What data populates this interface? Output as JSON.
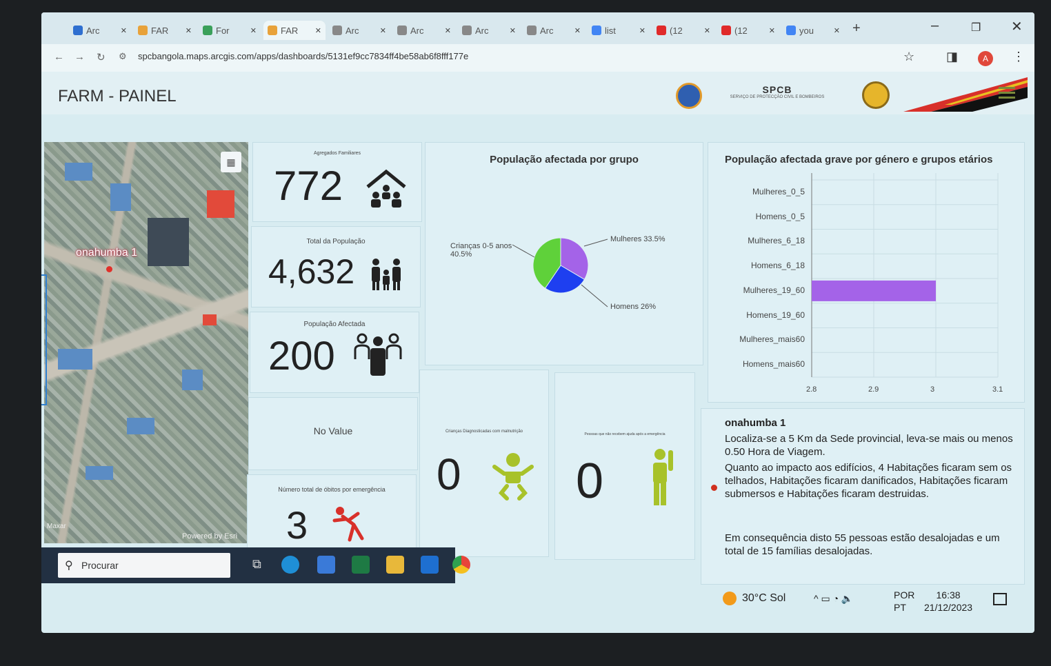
{
  "browser": {
    "tabs": [
      {
        "label": "Arc",
        "color": "#2f6fd0"
      },
      {
        "label": "FAR",
        "color": "#e8a23a"
      },
      {
        "label": "For",
        "color": "#3aa05a"
      },
      {
        "label": "FAR",
        "color": "#e8a23a",
        "active": true
      },
      {
        "label": "Arc",
        "color": "#888888"
      },
      {
        "label": "Arc",
        "color": "#888888"
      },
      {
        "label": "Arc",
        "color": "#888888"
      },
      {
        "label": "Arc",
        "color": "#888888"
      },
      {
        "label": "list",
        "color": "#4285f4"
      },
      {
        "label": "(12",
        "color": "#e02a2a"
      },
      {
        "label": "(12",
        "color": "#e02a2a"
      },
      {
        "label": "you",
        "color": "#4285f4"
      }
    ],
    "url": "spcbangola.maps.arcgis.com/apps/dashboards/5131ef9cc7834ff4be58ab6f8fff177e",
    "avatar": "A"
  },
  "dashboard": {
    "title": "FARM - PAINEL",
    "logo_text": "SPCB",
    "logo_subtext": "SERVIÇO DE PROTECÇÃO CIVIL E BOMBEIROS"
  },
  "map": {
    "label": "onahumba 1",
    "attribution": "Powered by Esri",
    "provider": "Maxar"
  },
  "kpis": {
    "agregados": {
      "caption": "Agregados Familiares",
      "value": "772"
    },
    "populacao": {
      "caption": "Total da População",
      "value": "4,632"
    },
    "afectada": {
      "caption": "População Afectada",
      "value": "200"
    },
    "novalue": {
      "caption": "No Value"
    },
    "obitos": {
      "caption": "Número total de óbitos por emergência",
      "value": "3"
    },
    "criancas": {
      "caption": "Crianças Diagnosticadas com malnutrição",
      "value": "0"
    },
    "pessoas": {
      "caption": "Pessoas que não recebem ajuda após a emergência",
      "value": "0"
    }
  },
  "pie": {
    "title": "População afectada por grupo",
    "chart_data": {
      "type": "pie",
      "slices": [
        {
          "label": "Mulheres",
          "value": 33.5,
          "color": "#a463e8"
        },
        {
          "label": "Homens",
          "value": 26,
          "color": "#1e3ff0"
        },
        {
          "label": "Crianças 0-5 anos",
          "value": 40.5,
          "color": "#5fd13a"
        }
      ]
    },
    "labels": {
      "criancas_1": "Crianças 0-5 anos",
      "criancas_2": "40.5%",
      "mulheres": "Mulheres 33.5%",
      "homens": "Homens 26%"
    }
  },
  "bar": {
    "title": "População afectada grave por género e grupos etários",
    "chart_data": {
      "type": "bar",
      "orientation": "horizontal",
      "categories": [
        "Mulheres_0_5",
        "Homens_0_5",
        "Mulheres_6_18",
        "Homens_6_18",
        "Mulheres_19_60",
        "Homens_19_60",
        "Mulheres_mais60",
        "Homens_mais60"
      ],
      "values": [
        null,
        null,
        null,
        null,
        3,
        null,
        null,
        null
      ],
      "xlim": [
        2.8,
        3.1
      ],
      "xticks": [
        "2.8",
        "2.9",
        "3",
        "3.1"
      ],
      "color": "#a463e8",
      "grid": true
    }
  },
  "info": {
    "title": "onahumba 1",
    "p1": "Localiza-se a 5 Km da Sede provincial, leva-se mais ou menos 0.50 Hora de Viagem.",
    "p2": "Quanto ao impacto aos edifícios, 4 Habitações ficaram sem os telhados,   Habitações ficaram danificados,  Habitações ficaram submersos e  Habitações ficaram destruidas.",
    "p3": "Em consequência disto 55 pessoas estão desalojadas e um total de 15 famílias desalojadas."
  },
  "taskbar": {
    "search_placeholder": "Procurar",
    "weather": "30°C  Sol",
    "lang1": "POR",
    "lang2": "PT",
    "time": "16:38",
    "date": "21/12/2023"
  }
}
